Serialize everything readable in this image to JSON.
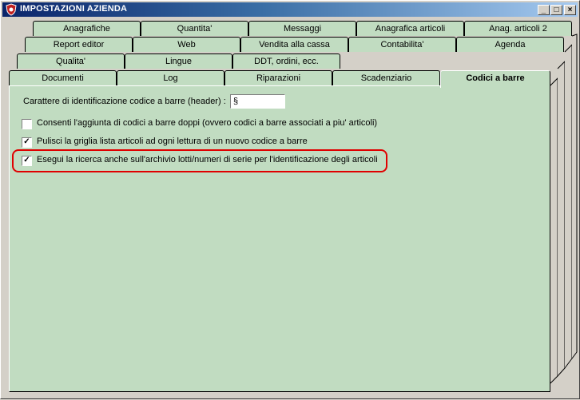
{
  "window": {
    "title": "IMPOSTAZIONI AZIENDA",
    "buttons": {
      "minimize": "_",
      "maximize": "□",
      "close": "×"
    }
  },
  "tabs": {
    "row1": [
      "Anagrafiche",
      "Quantita'",
      "Messaggi",
      "Anagrafica articoli",
      "Anag. articoli 2"
    ],
    "row2": [
      "Report editor",
      "Web",
      "Vendita alla cassa",
      "Contabilita'",
      "Agenda"
    ],
    "row3": [
      "Qualita'",
      "Lingue",
      "DDT, ordini, ecc."
    ],
    "row4": [
      "Documenti",
      "Log",
      "Riparazioni",
      "Scadenziario",
      "Codici a barre"
    ],
    "active": "Codici a barre"
  },
  "panel": {
    "header_char_label": "Carattere di identificazione codice a barre (header) :",
    "header_char_value": "§",
    "options": [
      {
        "label": "Consenti l'aggiunta di codici a barre doppi (ovvero codici a barre associati a piu' articoli)",
        "checked": false,
        "mark": ""
      },
      {
        "label": "Pulisci la griglia lista articoli ad ogni lettura di un nuovo codice a barre",
        "checked": true,
        "mark": "✓"
      },
      {
        "label": "Esegui la ricerca anche sull'archivio lotti/numeri di serie per l'identificazione degli articoli",
        "checked": true,
        "mark": "✓"
      }
    ]
  }
}
